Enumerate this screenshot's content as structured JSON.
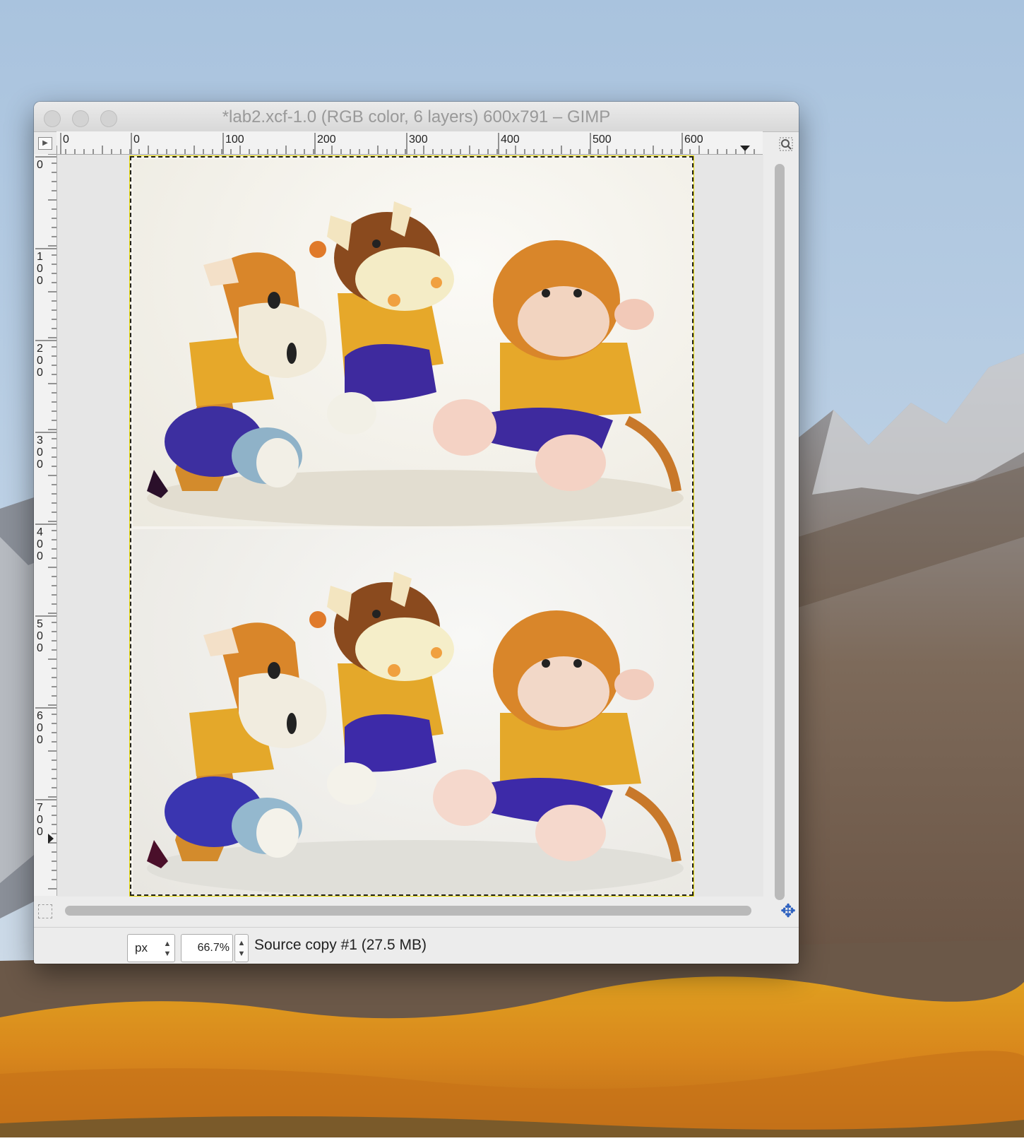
{
  "window": {
    "title": "*lab2.xcf-1.0 (RGB color, 6 layers) 600x791 – GIMP"
  },
  "rulers": {
    "horizontal_labels": [
      "0",
      "0",
      "100",
      "200",
      "300",
      "400",
      "500",
      "600"
    ],
    "vertical_labels": [
      "0",
      "100",
      "200",
      "300",
      "400",
      "500",
      "600",
      "700"
    ]
  },
  "icons": {
    "ruler_menu": "triangle-right-icon",
    "zoom_fit": "magnifier-icon",
    "quick_mask": "quick-mask-icon",
    "navigate": "four-arrow-move-icon"
  },
  "statusbar": {
    "unit": "px",
    "zoom": "66.7%",
    "status": "Source copy #1 (27.5 MB)"
  },
  "colors": {
    "selection_border": "#e6d800",
    "nav_icon": "#2f62c0",
    "plush_orange": "#d9862a",
    "plush_yellow": "#e8a72a",
    "plush_purple": "#3e2a9e"
  }
}
